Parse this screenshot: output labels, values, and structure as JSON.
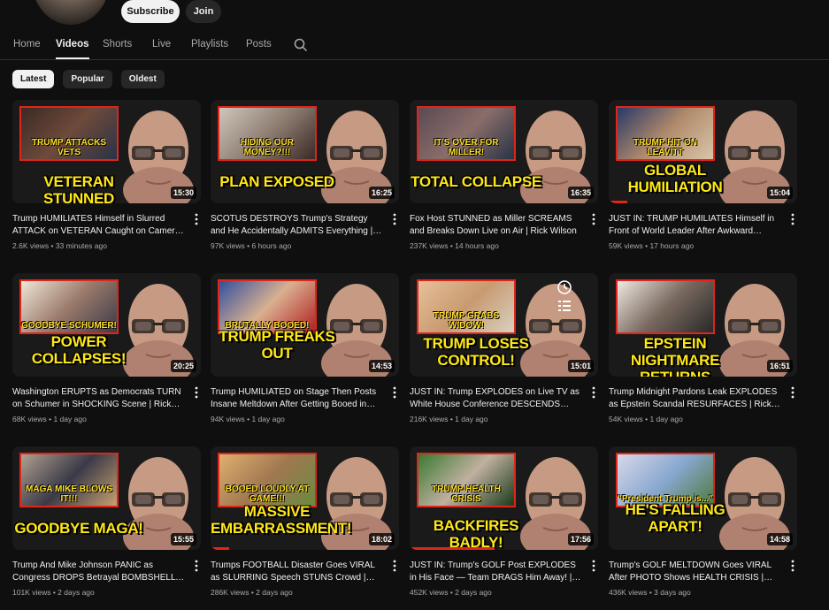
{
  "channel": {
    "subscribe_label": "Subscribe",
    "join_label": "Join"
  },
  "tabs": [
    {
      "label": "Home",
      "active": false
    },
    {
      "label": "Videos",
      "active": true
    },
    {
      "label": "Shorts",
      "active": false
    },
    {
      "label": "Live",
      "active": false
    },
    {
      "label": "Playlists",
      "active": false
    },
    {
      "label": "Posts",
      "active": false
    }
  ],
  "chips": [
    {
      "label": "Latest",
      "active": true
    },
    {
      "label": "Popular",
      "active": false
    },
    {
      "label": "Oldest",
      "active": false
    }
  ],
  "colors": {
    "accent_red": "#e0251b",
    "headline_yellow": "#ffe818",
    "background": "#0f0f0f"
  },
  "videos": [
    {
      "inset_caption": "TRUMP ATTACKS VETS",
      "headline": "VETERAN STUNNED",
      "duration": "15:30",
      "title": "Trump HUMILIATES Himself in Slurred ATTACK on VETERAN Caught on Camera |...",
      "views": "2.6K views",
      "age": "33 minutes ago",
      "progress": 0
    },
    {
      "inset_caption": "HIDING OUR MONEY?!!!",
      "headline": "PLAN EXPOSED",
      "duration": "16:25",
      "title": "SCOTUS DESTROYS Trump's Strategy and He Accidentally ADMITS Everything | Rick...",
      "views": "97K views",
      "age": "6 hours ago",
      "progress": 0
    },
    {
      "inset_caption": "IT'S OVER FOR MILLER!",
      "headline": "TOTAL COLLAPSE",
      "duration": "16:35",
      "title": "Fox Host STUNNED as Miller SCREAMS and Breaks Down Live on Air | Rick Wilson",
      "views": "237K views",
      "age": "14 hours ago",
      "progress": 0
    },
    {
      "inset_caption": "TRUMP HIT ON LEAVITT",
      "headline": "GLOBAL HUMILIATION",
      "duration": "15:04",
      "title": "JUST IN: TRUMP HUMILIATES Himself in Front of World Leader After Awkward Move...",
      "views": "59K views",
      "age": "17 hours ago",
      "progress": 0.1
    },
    {
      "inset_caption": "GOODBYE SCHUMER!",
      "headline": "POWER COLLAPSES!",
      "duration": "20:25",
      "title": "Washington ERUPTS as Democrats TURN on Schumer in SHOCKING Scene | Rick Wilson",
      "views": "68K views",
      "age": "1 day ago",
      "progress": 0
    },
    {
      "inset_caption": "BRUTALLY BOOED!",
      "headline": "TRUMP FREAKS OUT",
      "duration": "14:53",
      "title": "Trump HUMILIATED on Stage Then Posts Insane Meltdown After Getting Booed in Hi...",
      "views": "94K views",
      "age": "1 day ago",
      "progress": 0
    },
    {
      "inset_caption": "TRUMP GRABS WIDOW!",
      "headline": "TRUMP LOSES CONTROL!",
      "duration": "15:01",
      "title": "JUST IN: Trump EXPLODES on Live TV as White House Conference DESCENDS INTO...",
      "views": "216K views",
      "age": "1 day ago",
      "progress": 0
    },
    {
      "inset_caption": "",
      "headline": "EPSTEIN NIGHTMARE RETURNS",
      "duration": "16:51",
      "title": "Trump Midnight Pardons Leak EXPLODES as Epstein Scandal RESURFACES | Rick Wilson",
      "views": "54K views",
      "age": "1 day ago",
      "progress": 0
    },
    {
      "inset_caption": "MAGA MIKE BLOWS IT!!!",
      "headline": "GOODBYE MAGA!",
      "duration": "15:55",
      "title": "Trump And Mike Johnson PANIC as Congress DROPS Betrayal BOMBSHELL |...",
      "views": "101K views",
      "age": "2 days ago",
      "progress": 0
    },
    {
      "inset_caption": "BOOED LOUDLY AT GAME!!!",
      "headline": "MASSIVE EMBARRASSMENT!",
      "duration": "18:02",
      "title": "Trumps FOOTBALL Disaster Goes VIRAL as SLURRING Speech STUNS Crowd | Rick...",
      "views": "286K views",
      "age": "2 days ago",
      "progress": 0.1
    },
    {
      "inset_caption": "TRUMP HEALTH CRISIS",
      "headline": "BACKFIRES BADLY!",
      "duration": "17:56",
      "title": "JUST IN: Trump's GOLF Post EXPLODES in His Face — Team DRAGS Him Away! | Rick...",
      "views": "452K views",
      "age": "2 days ago",
      "progress": 0.45
    },
    {
      "inset_caption": "\"President Trump is...\"",
      "headline": "HE'S FALLING APART!",
      "duration": "14:58",
      "title": "Trump's GOLF MELTDOWN Goes VIRAL After PHOTO Shows HEALTH CRISIS | Rick Wilson",
      "views": "436K views",
      "age": "3 days ago",
      "progress": 0
    }
  ]
}
